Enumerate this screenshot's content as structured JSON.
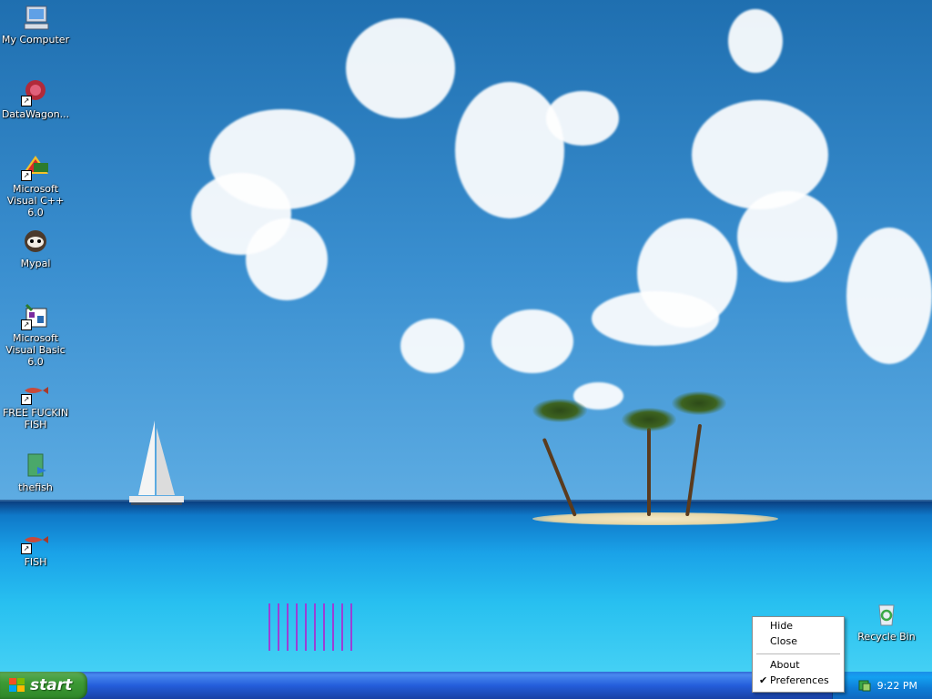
{
  "desktop": {
    "icons": [
      {
        "label": "My Computer",
        "icon": "my-computer-icon",
        "shortcut": false
      },
      {
        "label": "DataWagon...",
        "icon": "datawagon-icon",
        "shortcut": true
      },
      {
        "label": "Microsoft Visual C++ 6.0",
        "icon": "visual-cpp-icon",
        "shortcut": true
      },
      {
        "label": "Mypal",
        "icon": "mypal-icon",
        "shortcut": false
      },
      {
        "label": "Microsoft Visual Basic 6.0",
        "icon": "visual-basic-icon",
        "shortcut": true
      },
      {
        "label": "FREE FUCKIN FISH",
        "icon": "fish-icon",
        "shortcut": true
      },
      {
        "label": "thefish",
        "icon": "folder-icon",
        "shortcut": false
      },
      {
        "label": "FISH",
        "icon": "fish-icon",
        "shortcut": true
      }
    ],
    "recycle_bin": {
      "label": "Recycle Bin",
      "icon": "recycle-bin-icon"
    }
  },
  "context_menu": {
    "items": [
      {
        "label": "Hide",
        "checked": false
      },
      {
        "label": "Close",
        "checked": false
      },
      {
        "label": "About",
        "checked": false
      },
      {
        "label": "Preferences",
        "checked": true
      }
    ]
  },
  "taskbar": {
    "start_label": "start",
    "clock": "9:22 PM",
    "tray_icon": "tray-app-icon"
  },
  "colors": {
    "taskbar": "#245edb",
    "start_button": "#3c9a35",
    "tray": "#0e7dd6"
  }
}
